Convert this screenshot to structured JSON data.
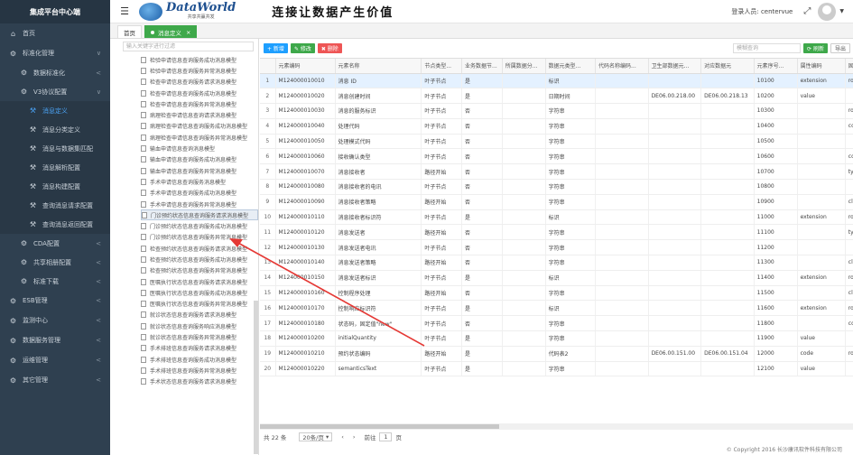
{
  "app": {
    "title": "集成平台中心端",
    "slogan": "连接让数据产生价值",
    "logo_text": "DataWorld",
    "logo_sub": "共享共赢共发"
  },
  "user": {
    "label": "登录人员: centervue"
  },
  "sidebar": {
    "items": [
      {
        "label": "首页",
        "icon": "home-icon",
        "level": 0
      },
      {
        "label": "标准化管理",
        "icon": "gear-icon",
        "level": 0,
        "arrow": "∨"
      },
      {
        "label": "数据标准化",
        "icon": "gear-icon",
        "level": 1,
        "arrow": "<"
      },
      {
        "label": "V3协议配置",
        "icon": "gear-icon",
        "level": 1,
        "arrow": "∨"
      },
      {
        "label": "消息定义",
        "icon": "wrench-icon",
        "level": 2,
        "active": true
      },
      {
        "label": "消息分类定义",
        "icon": "wrench-icon",
        "level": 2
      },
      {
        "label": "消息与数据集匹配",
        "icon": "wrench-icon",
        "level": 2
      },
      {
        "label": "消息解析配置",
        "icon": "wrench-icon",
        "level": 2
      },
      {
        "label": "消息构建配置",
        "icon": "wrench-icon",
        "level": 2
      },
      {
        "label": "查询消息请求配置",
        "icon": "wrench-icon",
        "level": 2
      },
      {
        "label": "查询消息返回配置",
        "icon": "wrench-icon",
        "level": 2
      },
      {
        "label": "CDA配置",
        "icon": "gear-icon",
        "level": 1,
        "arrow": "<"
      },
      {
        "label": "共享相册配置",
        "icon": "gear-icon",
        "level": 1,
        "arrow": "<"
      },
      {
        "label": "标准下载",
        "icon": "gear-icon",
        "level": 1,
        "arrow": "<"
      },
      {
        "label": "ESB管理",
        "icon": "gear-icon",
        "level": 0,
        "arrow": "<"
      },
      {
        "label": "监测中心",
        "icon": "gear-icon",
        "level": 0,
        "arrow": "<"
      },
      {
        "label": "数据服务管理",
        "icon": "gear-icon",
        "level": 0,
        "arrow": "<"
      },
      {
        "label": "运维管理",
        "icon": "gear-icon",
        "level": 0,
        "arrow": "<"
      },
      {
        "label": "其它管理",
        "icon": "gear-icon",
        "level": 0,
        "arrow": "<"
      }
    ]
  },
  "tabs": [
    {
      "label": "首页"
    },
    {
      "label": "消息定义",
      "active": true
    }
  ],
  "tree": {
    "search_placeholder": "输入关键字进行过滤",
    "items": [
      "检验申请信息查询服务成功消息模型",
      "检验申请信息查询服务异常消息模型",
      "检查申请信息查询服务请求消息模型",
      "检查申请信息查询服务成功消息模型",
      "检查申请信息查询服务异常消息模型",
      "病理检查申请信息查询请求消息模型",
      "病理检查申请信息查询服务成功消息模型",
      "病理检查申请信息查询服务异常消息模型",
      "输血申请信息查询消息模型",
      "输血申请信息查询服务成功消息模型",
      "输血申请信息查询服务异常消息模型",
      "手术申请信息查询服务消息模型",
      "手术申请信息查询服务成功消息模型",
      "手术申请信息查询服务异常消息模型",
      "门诊预约状态信息查询服务请求消息模型",
      "门诊预约状态信息查询服务成功消息模型",
      "门诊预约状态信息查询服务异常消息模型",
      "检查预约状态信息查询服务请求消息模型",
      "检查预约状态信息查询服务成功消息模型",
      "检查预约状态信息查询服务异常消息模型",
      "医嘱执行状态信息查询服务请求消息模型",
      "医嘱执行状态信息查询服务成功消息模型",
      "医嘱执行状态信息查询服务异常消息模型",
      "就诊状态信息查询服务请求消息模型",
      "就诊状态信息查询服务响应消息模型",
      "就诊状态信息查询服务异常消息模型",
      "手术排班信息查询服务请求消息模型",
      "手术排班信息查询服务成功消息模型",
      "手术排班信息查询服务异常消息模型",
      "手术状态信息查询服务请求消息模型"
    ],
    "selected_index": 14
  },
  "toolbar": {
    "add": "+ 新增",
    "edit": "✎ 修改",
    "delete": "✖ 删除",
    "search_placeholder": "模糊查询",
    "refresh": "⟳ 刷新",
    "export": "导出"
  },
  "table": {
    "columns": [
      "",
      "元素编码",
      "元素名称",
      "节点类型...",
      "业务数据节...",
      "所属数据分...",
      "数据元类型...",
      "代码名称编码...",
      "卫生部数据元...",
      "对应数据元",
      "元素序号...",
      "属性编码",
      "固定属性..."
    ],
    "rows": [
      [
        "1",
        "M124000010010",
        "消息 ID",
        "叶子节点",
        "是",
        "",
        "标识",
        "",
        "",
        "",
        "10100",
        "extension",
        "root=\"2.1"
      ],
      [
        "2",
        "M124000010020",
        "消息创建时间",
        "叶子节点",
        "是",
        "",
        "日期时间",
        "",
        "DE06.00.218.00",
        "DE06.00.218.13",
        "10200",
        "value",
        ""
      ],
      [
        "3",
        "M124000010030",
        "消息的服务标识",
        "叶子节点",
        "否",
        "",
        "字符串",
        "",
        "",
        "",
        "10300",
        "",
        "root=\"2.1"
      ],
      [
        "4",
        "M124000010040",
        "处理代码",
        "叶子节点",
        "否",
        "",
        "字符串",
        "",
        "",
        "",
        "10400",
        "",
        "code=\"P"
      ],
      [
        "5",
        "M124000010050",
        "处理模式代码",
        "叶子节点",
        "否",
        "",
        "字符串",
        "",
        "",
        "",
        "10500",
        "",
        ""
      ],
      [
        "6",
        "M124000010060",
        "接收确认类型",
        "叶子节点",
        "否",
        "",
        "字符串",
        "",
        "",
        "",
        "10600",
        "",
        "code=\"AI"
      ],
      [
        "7",
        "M124000010070",
        "消息接收者",
        "路径开始",
        "否",
        "",
        "字符串",
        "",
        "",
        "",
        "10700",
        "",
        "typeCode"
      ],
      [
        "8",
        "M124000010080",
        "消息接收者的电讯",
        "叶子节点",
        "否",
        "",
        "字符串",
        "",
        "",
        "",
        "10800",
        "",
        ""
      ],
      [
        "9",
        "M124000010090",
        "消息接收者策略",
        "路径开始",
        "否",
        "",
        "字符串",
        "",
        "",
        "",
        "10900",
        "",
        "classCode"
      ],
      [
        "10",
        "M124000010110",
        "消息接收者标识符",
        "叶子节点",
        "是",
        "",
        "标识",
        "",
        "",
        "",
        "11000",
        "extension",
        "root=\"2.1"
      ],
      [
        "11",
        "M124000010120",
        "消息发送者",
        "路径开始",
        "否",
        "",
        "字符串",
        "",
        "",
        "",
        "11100",
        "",
        "typeCode"
      ],
      [
        "12",
        "M124000010130",
        "消息发送者电讯",
        "叶子节点",
        "否",
        "",
        "字符串",
        "",
        "",
        "",
        "11200",
        "",
        ""
      ],
      [
        "13",
        "M124000010140",
        "消息发送者策略",
        "路径开始",
        "否",
        "",
        "字符串",
        "",
        "",
        "",
        "11300",
        "",
        "classCode"
      ],
      [
        "14",
        "M124000010150",
        "消息发送者标识",
        "叶子节点",
        "是",
        "",
        "标识",
        "",
        "",
        "",
        "11400",
        "extension",
        "root=\"2.1"
      ],
      [
        "15",
        "M124000010160",
        "控制程序处理",
        "路径开始",
        "否",
        "",
        "字符串",
        "",
        "",
        "",
        "11500",
        "",
        "classCode"
      ],
      [
        "16",
        "M124000010170",
        "控制响应标识符",
        "叶子节点",
        "是",
        "",
        "标识",
        "",
        "",
        "",
        "11600",
        "extension",
        "root=\"2.1"
      ],
      [
        "17",
        "M124000010180",
        "状态码，固定值\"new\"",
        "叶子节点",
        "否",
        "",
        "字符串",
        "",
        "",
        "",
        "11800",
        "",
        "code=\"ne"
      ],
      [
        "18",
        "M124000010200",
        "initialQuantity",
        "叶子节点",
        "是",
        "",
        "字符串",
        "",
        "",
        "",
        "11900",
        "value",
        ""
      ],
      [
        "19",
        "M124000010210",
        "预约状态编码",
        "路径开始",
        "是",
        "",
        "代码表2",
        "",
        "DE06.00.151.00",
        "DE06.00.151.04",
        "12000",
        "code",
        "root=\"2.1"
      ],
      [
        "20",
        "M124000010220",
        "semanticsText",
        "叶子节点",
        "是",
        "",
        "字符串",
        "",
        "",
        "",
        "12100",
        "value",
        ""
      ]
    ]
  },
  "pager": {
    "total": "共 22 条",
    "per_page": "20条/页",
    "prev": "前往",
    "page": "1",
    "unit": "页"
  },
  "footer": "© Copyright 2016 长沙康讯软件科技有限公司",
  "colors": {
    "sidebar": "#2f4050",
    "accent_green": "#3ea84a",
    "accent_blue": "#1e9fff",
    "arrow": "#e53935"
  }
}
